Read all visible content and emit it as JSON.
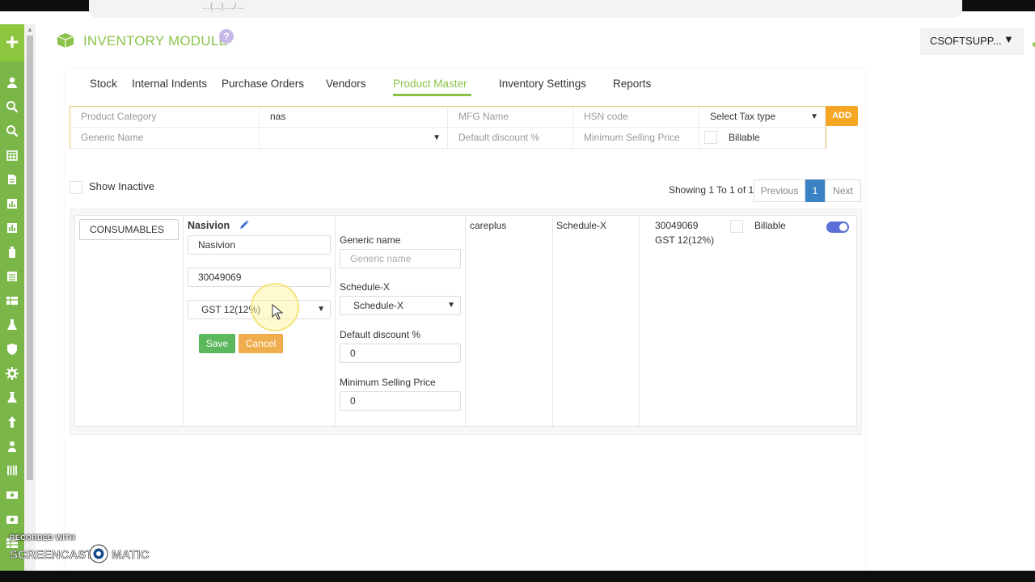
{
  "browser": {
    "url_fragment": "…(…)…,/…"
  },
  "header": {
    "module_title": "INVENTORY MODULE",
    "help_glyph": "?",
    "user_label": "CSOFTSUPP...",
    "user_caret": "▼"
  },
  "sidebar": {
    "add_glyph": "+",
    "icons": [
      "user-icon",
      "search-icon",
      "search-icon",
      "calendar-icon",
      "document-icon",
      "chart-icon",
      "chart-icon",
      "bottle-icon",
      "list-icon",
      "table-icon",
      "flask-icon",
      "shield-icon",
      "gear-icon",
      "beaker-icon",
      "arrow-up-icon",
      "person-icon",
      "grid-icon",
      "money-icon",
      "camera-icon",
      "table-icon"
    ]
  },
  "tabs": [
    {
      "label": "Stock"
    },
    {
      "label": "Internal Indents"
    },
    {
      "label": "Purchase Orders"
    },
    {
      "label": "Vendors"
    },
    {
      "label": "Product Master",
      "active": true
    },
    {
      "label": "Inventory Settings"
    },
    {
      "label": "Reports"
    }
  ],
  "form": {
    "product_category_placeholder": "Product Category",
    "name_value": "nas",
    "mfg_placeholder": "MFG Name",
    "hsn_placeholder": "HSN code",
    "tax_select": "Select Tax type",
    "add_label": "ADD",
    "generic_placeholder": "Generic Name",
    "schedule_select": "",
    "default_discount_placeholder": "Default discount %",
    "min_selling_placeholder": "Minimum Selling Price",
    "billable_label": "Billable"
  },
  "filter": {
    "show_inactive_label": "Show Inactive",
    "showing_text": "Showing 1 To 1 of 1",
    "previous_label": "Previous",
    "page_1": "1",
    "next_label": "Next"
  },
  "row": {
    "category_value": "CONSUMABLES",
    "product_name_heading": "Nasivion",
    "product_name_value": "Nasivion",
    "hsn_value": "30049069",
    "tax_value": "GST 12(12%)",
    "save_label": "Save",
    "cancel_label": "Cancel",
    "generic_name_label": "Generic name",
    "generic_name_placeholder": "Generic name",
    "schedule_label": "Schedule-X",
    "schedule_value": "Schedule-X",
    "default_discount_label": "Default discount %",
    "default_discount_value": "0",
    "min_selling_label": "Minimum Selling Price",
    "min_selling_value": "0",
    "mfg_value": "careplus",
    "schedule_col_value": "Schedule-X",
    "hsn_col_value": "30049069",
    "tax_col_value": "GST 12(12%)",
    "billable_label": "Billable",
    "active_toggle": true
  },
  "watermark": {
    "recorded_with": "RECORDED WITH",
    "brand": "SCREENCAST-O-MATIC"
  },
  "colors": {
    "brand_green": "#8bc34a",
    "sidebar_green": "#7ab648",
    "form_border": "#e8c86b",
    "add_orange": "#f5a623",
    "save_green": "#5cb85c",
    "cancel_orange": "#f0ad4e",
    "pager_blue": "#3b82c4",
    "toggle_blue": "#5b6fd8"
  }
}
